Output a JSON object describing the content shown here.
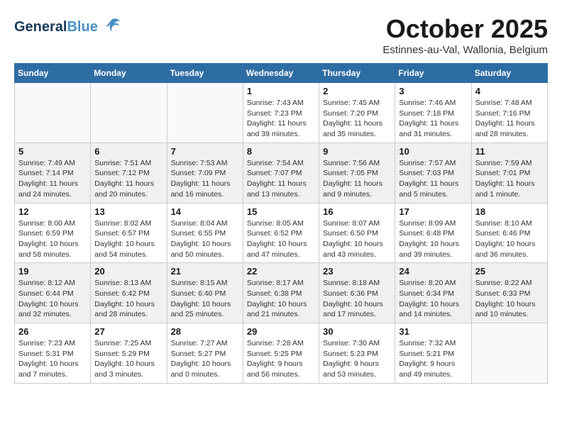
{
  "header": {
    "logo_general": "General",
    "logo_blue": "Blue",
    "month": "October 2025",
    "location": "Estinnes-au-Val, Wallonia, Belgium"
  },
  "weekdays": [
    "Sunday",
    "Monday",
    "Tuesday",
    "Wednesday",
    "Thursday",
    "Friday",
    "Saturday"
  ],
  "weeks": [
    [
      {
        "day": "",
        "info": "",
        "empty": true
      },
      {
        "day": "",
        "info": "",
        "empty": true
      },
      {
        "day": "",
        "info": "",
        "empty": true
      },
      {
        "day": "1",
        "info": "Sunrise: 7:43 AM\nSunset: 7:23 PM\nDaylight: 11 hours\nand 39 minutes."
      },
      {
        "day": "2",
        "info": "Sunrise: 7:45 AM\nSunset: 7:20 PM\nDaylight: 11 hours\nand 35 minutes."
      },
      {
        "day": "3",
        "info": "Sunrise: 7:46 AM\nSunset: 7:18 PM\nDaylight: 11 hours\nand 31 minutes."
      },
      {
        "day": "4",
        "info": "Sunrise: 7:48 AM\nSunset: 7:16 PM\nDaylight: 11 hours\nand 28 minutes."
      }
    ],
    [
      {
        "day": "5",
        "info": "Sunrise: 7:49 AM\nSunset: 7:14 PM\nDaylight: 11 hours\nand 24 minutes.",
        "shaded": true
      },
      {
        "day": "6",
        "info": "Sunrise: 7:51 AM\nSunset: 7:12 PM\nDaylight: 11 hours\nand 20 minutes.",
        "shaded": true
      },
      {
        "day": "7",
        "info": "Sunrise: 7:53 AM\nSunset: 7:09 PM\nDaylight: 11 hours\nand 16 minutes.",
        "shaded": true
      },
      {
        "day": "8",
        "info": "Sunrise: 7:54 AM\nSunset: 7:07 PM\nDaylight: 11 hours\nand 13 minutes.",
        "shaded": true
      },
      {
        "day": "9",
        "info": "Sunrise: 7:56 AM\nSunset: 7:05 PM\nDaylight: 11 hours\nand 9 minutes.",
        "shaded": true
      },
      {
        "day": "10",
        "info": "Sunrise: 7:57 AM\nSunset: 7:03 PM\nDaylight: 11 hours\nand 5 minutes.",
        "shaded": true
      },
      {
        "day": "11",
        "info": "Sunrise: 7:59 AM\nSunset: 7:01 PM\nDaylight: 11 hours\nand 1 minute.",
        "shaded": true
      }
    ],
    [
      {
        "day": "12",
        "info": "Sunrise: 8:00 AM\nSunset: 6:59 PM\nDaylight: 10 hours\nand 58 minutes."
      },
      {
        "day": "13",
        "info": "Sunrise: 8:02 AM\nSunset: 6:57 PM\nDaylight: 10 hours\nand 54 minutes."
      },
      {
        "day": "14",
        "info": "Sunrise: 8:04 AM\nSunset: 6:55 PM\nDaylight: 10 hours\nand 50 minutes."
      },
      {
        "day": "15",
        "info": "Sunrise: 8:05 AM\nSunset: 6:52 PM\nDaylight: 10 hours\nand 47 minutes."
      },
      {
        "day": "16",
        "info": "Sunrise: 8:07 AM\nSunset: 6:50 PM\nDaylight: 10 hours\nand 43 minutes."
      },
      {
        "day": "17",
        "info": "Sunrise: 8:09 AM\nSunset: 6:48 PM\nDaylight: 10 hours\nand 39 minutes."
      },
      {
        "day": "18",
        "info": "Sunrise: 8:10 AM\nSunset: 6:46 PM\nDaylight: 10 hours\nand 36 minutes."
      }
    ],
    [
      {
        "day": "19",
        "info": "Sunrise: 8:12 AM\nSunset: 6:44 PM\nDaylight: 10 hours\nand 32 minutes.",
        "shaded": true
      },
      {
        "day": "20",
        "info": "Sunrise: 8:13 AM\nSunset: 6:42 PM\nDaylight: 10 hours\nand 28 minutes.",
        "shaded": true
      },
      {
        "day": "21",
        "info": "Sunrise: 8:15 AM\nSunset: 6:40 PM\nDaylight: 10 hours\nand 25 minutes.",
        "shaded": true
      },
      {
        "day": "22",
        "info": "Sunrise: 8:17 AM\nSunset: 6:38 PM\nDaylight: 10 hours\nand 21 minutes.",
        "shaded": true
      },
      {
        "day": "23",
        "info": "Sunrise: 8:18 AM\nSunset: 6:36 PM\nDaylight: 10 hours\nand 17 minutes.",
        "shaded": true
      },
      {
        "day": "24",
        "info": "Sunrise: 8:20 AM\nSunset: 6:34 PM\nDaylight: 10 hours\nand 14 minutes.",
        "shaded": true
      },
      {
        "day": "25",
        "info": "Sunrise: 8:22 AM\nSunset: 6:33 PM\nDaylight: 10 hours\nand 10 minutes.",
        "shaded": true
      }
    ],
    [
      {
        "day": "26",
        "info": "Sunrise: 7:23 AM\nSunset: 5:31 PM\nDaylight: 10 hours\nand 7 minutes."
      },
      {
        "day": "27",
        "info": "Sunrise: 7:25 AM\nSunset: 5:29 PM\nDaylight: 10 hours\nand 3 minutes."
      },
      {
        "day": "28",
        "info": "Sunrise: 7:27 AM\nSunset: 5:27 PM\nDaylight: 10 hours\nand 0 minutes."
      },
      {
        "day": "29",
        "info": "Sunrise: 7:28 AM\nSunset: 5:25 PM\nDaylight: 9 hours\nand 56 minutes."
      },
      {
        "day": "30",
        "info": "Sunrise: 7:30 AM\nSunset: 5:23 PM\nDaylight: 9 hours\nand 53 minutes."
      },
      {
        "day": "31",
        "info": "Sunrise: 7:32 AM\nSunset: 5:21 PM\nDaylight: 9 hours\nand 49 minutes."
      },
      {
        "day": "",
        "info": "",
        "empty": true
      }
    ]
  ]
}
